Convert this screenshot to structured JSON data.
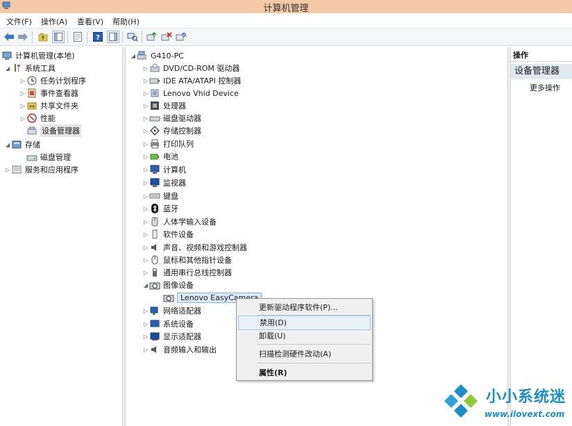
{
  "window": {
    "title": "计算机管理"
  },
  "menu": [
    "文件(F)",
    "操作(A)",
    "查看(V)",
    "帮助(H)"
  ],
  "left_tree": {
    "root": "计算机管理(本地)",
    "system_tools": "系统工具",
    "task_scheduler": "任务计划程序",
    "event_viewer": "事件查看器",
    "shared_folders": "共享文件夹",
    "performance": "性能",
    "device_manager": "设备管理器",
    "storage": "存储",
    "disk_management": "磁盘管理",
    "services_apps": "服务和应用程序"
  },
  "device_tree": {
    "root": "G410-PC",
    "categories": [
      "DVD/CD-ROM 驱动器",
      "IDE ATA/ATAPI 控制器",
      "Lenovo Vhid Device",
      "处理器",
      "磁盘驱动器",
      "存储控制器",
      "打印队列",
      "电池",
      "计算机",
      "监视器",
      "键盘",
      "蓝牙",
      "人体学输入设备",
      "软件设备",
      "声音、视频和游戏控制器",
      "鼠标和其他指针设备",
      "通用串行总线控制器",
      "图像设备",
      "Lenovo EasyCamera",
      "网络适配器",
      "系统设备",
      "显示适配器",
      "音频输入和输出"
    ]
  },
  "actions": {
    "header": "操作",
    "section": "设备管理器",
    "more": "更多操作"
  },
  "context_menu": [
    "更新驱动程序软件(P)...",
    "禁用(D)",
    "卸载(U)",
    "扫描检测硬件改动(A)",
    "属性(R)"
  ],
  "watermark": {
    "name": "小小系统迷",
    "url": "www.ilovext.com"
  }
}
